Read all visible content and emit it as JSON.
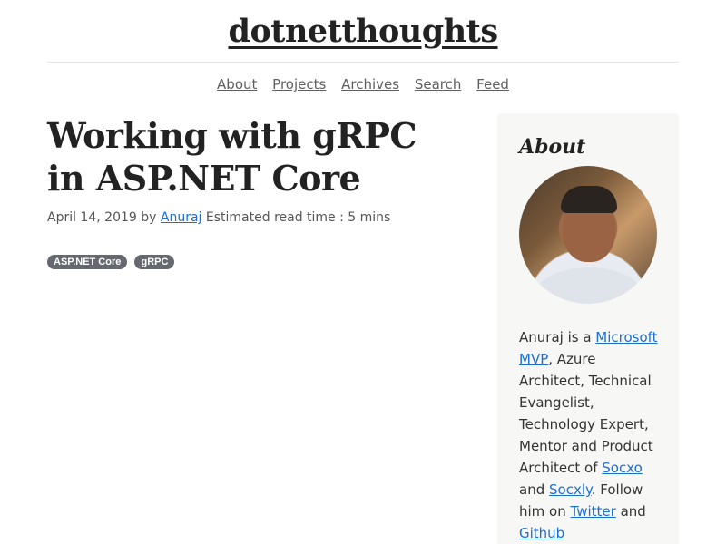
{
  "site": {
    "title": "dotnetthoughts"
  },
  "nav": {
    "items": [
      "About",
      "Projects",
      "Archives",
      "Search",
      "Feed"
    ]
  },
  "post": {
    "title": "Working with gRPC in ASP.NET Core",
    "date": "April 14, 2019",
    "by": "by",
    "author": "Anuraj",
    "read_time": "Estimated read time : 5 mins",
    "tags": [
      "ASP.NET Core",
      "gRPC"
    ]
  },
  "sidebar": {
    "heading": "About",
    "bio": {
      "t1": "Anuraj is a ",
      "link_mvp": "Microsoft MVP",
      "t2": ", Azure Architect, Technical Evangelist, Technology Expert, Mentor and Product Architect of ",
      "link_socxo": "Socxo",
      "t3": " and ",
      "link_socxly": "Socxly",
      "t4": ". Follow him on ",
      "link_twitter": "Twitter",
      "t5": " and ",
      "link_github": "Github"
    }
  }
}
